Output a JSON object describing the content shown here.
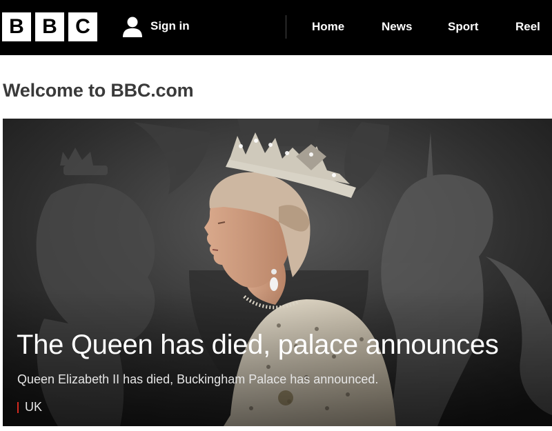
{
  "header": {
    "logo_letters": [
      "B",
      "B",
      "C"
    ],
    "sign_in_label": "Sign in",
    "nav_items": [
      "Home",
      "News",
      "Sport",
      "Reel"
    ]
  },
  "welcome_title": "Welcome to BBC.com",
  "hero": {
    "headline": "The Queen has died, palace announces",
    "summary": "Queen Elizabeth II has died, Buckingham Palace has announced.",
    "tag": "UK",
    "tag_color": "#d42a20"
  },
  "icons": {
    "sign_in": "user-icon"
  }
}
